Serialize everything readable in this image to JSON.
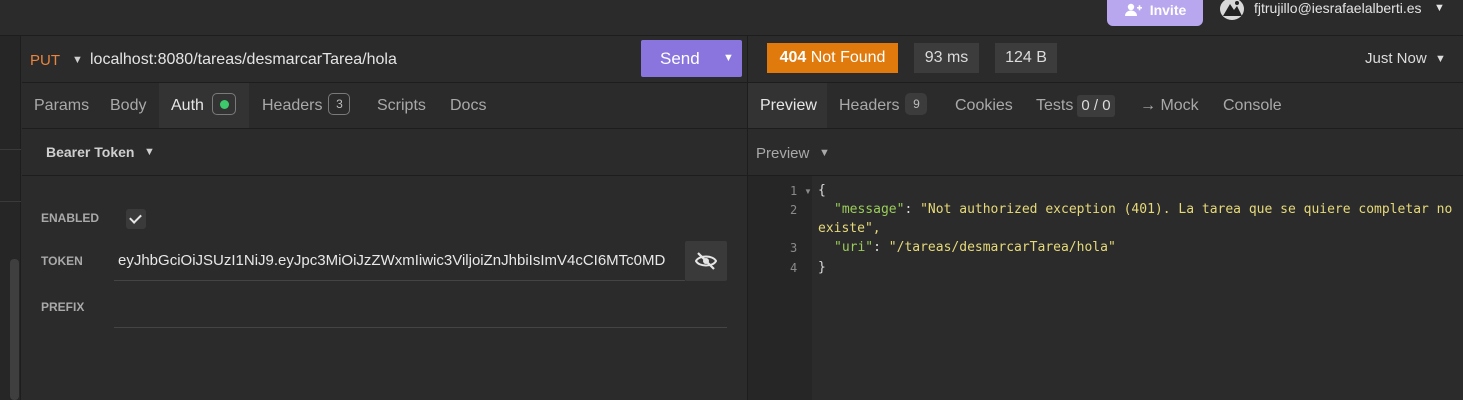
{
  "header": {
    "invite_label": "Invite",
    "user_email": "fjtrujillo@iesrafaelalberti.es"
  },
  "request": {
    "method": "PUT",
    "url": "localhost:8080/tareas/desmarcarTarea/hola",
    "send_label": "Send",
    "tabs": [
      {
        "label": "Params"
      },
      {
        "label": "Body"
      },
      {
        "label": "Auth"
      },
      {
        "label": "Headers",
        "count": "3"
      },
      {
        "label": "Scripts"
      },
      {
        "label": "Docs"
      }
    ],
    "active_tab": "Auth",
    "auth": {
      "type_label": "Bearer Token",
      "enabled_label": "ENABLED",
      "enabled": true,
      "token_label": "TOKEN",
      "token_value": "eyJhbGciOiJSUzI1NiJ9.eyJpc3MiOiJzZWxmIiwic3ViljoiZnJhbiIsImV4cCI6MTc0MD",
      "prefix_label": "PREFIX",
      "prefix_value": ""
    }
  },
  "response": {
    "status_code": "404",
    "status_text": "Not Found",
    "time": "93 ms",
    "size": "124 B",
    "history_label": "Just Now",
    "tabs": [
      {
        "label": "Preview"
      },
      {
        "label": "Headers",
        "count": "9"
      },
      {
        "label": "Cookies"
      },
      {
        "label": "Tests",
        "count": "0 / 0"
      },
      {
        "label": "→ Mock"
      },
      {
        "label": "Console"
      }
    ],
    "active_tab": "Preview",
    "preview_mode": "Preview",
    "body_lines": [
      {
        "n": "1",
        "text": "{"
      },
      {
        "n": "2",
        "key": "\"message\"",
        "value": "\"Not authorized exception (401). La tarea que se quiere completar no",
        "cont": "existe\","
      },
      {
        "n": "3",
        "key": "\"uri\"",
        "value": "\"/tareas/desmarcarTarea/hola\""
      },
      {
        "n": "4",
        "text": "}"
      }
    ]
  },
  "colors": {
    "accent": "#8a75de",
    "method_put": "#e8853e",
    "status_404": "#e07a0c",
    "json_key": "#9acd5a",
    "json_string": "#e6d97a"
  }
}
